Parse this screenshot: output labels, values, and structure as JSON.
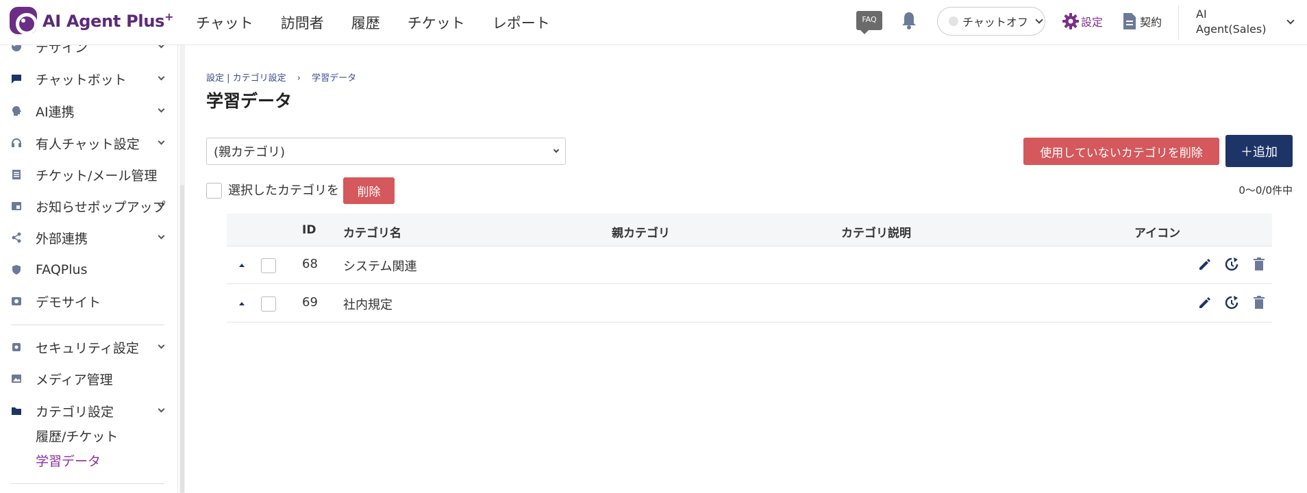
{
  "brand": {
    "name": "AI Agent Plus",
    "plus": "+"
  },
  "nav": [
    "チャット",
    "訪問者",
    "履歴",
    "チケット",
    "レポート"
  ],
  "header": {
    "faq_badge": "FAQ",
    "chat_toggle": "チャットオフ",
    "settings": "設定",
    "contract": "契約",
    "user_line1": "AI",
    "user_line2": "Agent(Sales)"
  },
  "sidebar": {
    "items": [
      {
        "label": "デザイン",
        "icon": "palette-icon",
        "expandable": true
      },
      {
        "label": "チャットボット",
        "icon": "chat-icon",
        "expandable": true
      },
      {
        "label": "AI連携",
        "icon": "brain-icon",
        "expandable": true
      },
      {
        "label": "有人チャット設定",
        "icon": "headset-icon",
        "expandable": true
      },
      {
        "label": "チケット/メール管理",
        "icon": "ticket-icon",
        "expandable": false
      },
      {
        "label": "お知らせポップアップ",
        "icon": "popup-icon",
        "expandable": true
      },
      {
        "label": "外部連携",
        "icon": "share-icon",
        "expandable": true
      },
      {
        "label": "FAQPlus",
        "icon": "shield-icon",
        "expandable": false
      },
      {
        "label": "デモサイト",
        "icon": "monitor-icon",
        "expandable": false
      },
      {
        "label": "セキュリティ設定",
        "icon": "lock-icon",
        "expandable": true
      },
      {
        "label": "メディア管理",
        "icon": "image-icon",
        "expandable": false
      },
      {
        "label": "カテゴリ設定",
        "icon": "folder-icon",
        "expandable": true
      }
    ],
    "sub_items": [
      {
        "label": "履歴/チケット",
        "active": false
      },
      {
        "label": "学習データ",
        "active": true
      }
    ]
  },
  "main": {
    "breadcrumb_parent": "設定 | カテゴリ設定",
    "breadcrumb_sep": "›",
    "breadcrumb_current": "学習データ",
    "title": "学習データ",
    "parent_select": "(親カテゴリ)",
    "delete_unused_label": "使用していないカテゴリを削除",
    "add_label": "＋追加",
    "selected_label": "選択したカテゴリを",
    "delete_label": "削除",
    "count": "0〜0/0件中"
  },
  "table": {
    "headers": {
      "id": "ID",
      "name": "カテゴリ名",
      "parent": "親カテゴリ",
      "desc": "カテゴリ説明",
      "icon": "アイコン"
    },
    "rows": [
      {
        "id": "68",
        "name": "システム関連"
      },
      {
        "id": "69",
        "name": "社内規定"
      }
    ]
  },
  "colors": {
    "brand": "#6b2d86",
    "primary": "#1c3466",
    "danger": "#d4585c",
    "active": "#8b2f9d"
  }
}
